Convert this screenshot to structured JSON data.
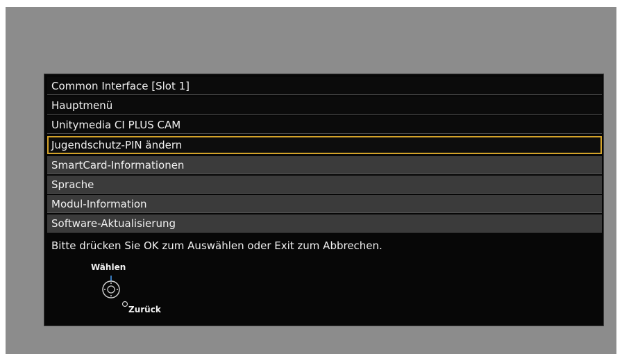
{
  "dialog": {
    "title": "Common Interface [Slot 1]",
    "info_lines": [
      "Hauptmenü",
      "Unitymedia CI PLUS CAM"
    ],
    "menu_items": [
      "Jugendschutz-PIN ändern",
      "SmartCard-Informationen",
      "Sprache",
      "Modul-Information",
      "Software-Aktualisierung"
    ],
    "selected_index": 0,
    "footer_text": "Bitte drücken Sie OK zum Auswählen oder Exit zum Abbrechen."
  },
  "legend": {
    "select_label": "Wählen",
    "select_icon": "dpad-icon",
    "back_label": "Zurück",
    "back_icon": "back-button-icon"
  },
  "colors": {
    "background": "#8c8c8c",
    "panel": "#070707",
    "menu_item": "#3b3b3b",
    "highlight_border": "#d4a32a",
    "accent_blue": "#4aa3ff"
  }
}
